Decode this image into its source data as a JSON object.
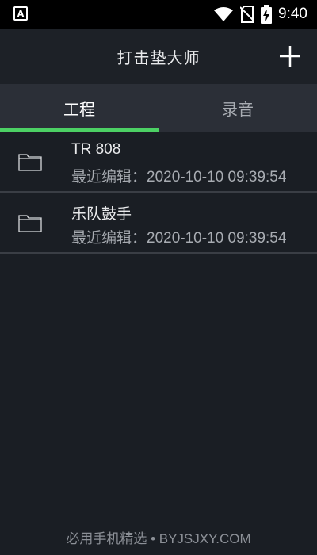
{
  "status_bar": {
    "left_icon": "accessibility-a-icon",
    "left_glyph": "A",
    "icons": [
      "wifi-icon",
      "no-sim-icon",
      "battery-charging-icon"
    ],
    "time": "9:40"
  },
  "app_bar": {
    "title": "打击垫大师",
    "add_icon": "plus-icon"
  },
  "tabs": [
    {
      "label": "工程",
      "active": true
    },
    {
      "label": "录音",
      "active": false
    }
  ],
  "accent_color": "#4cd164",
  "projects": [
    {
      "icon": "folder-icon",
      "name": "TR 808",
      "edited": "最近编辑：2020-10-10 09:39:54"
    },
    {
      "icon": "folder-icon",
      "name": "乐队鼓手",
      "edited": "最近编辑：2020-10-10 09:39:54"
    }
  ],
  "footer": {
    "watermark": "必用手机精选 • BYJSJXY.COM"
  }
}
